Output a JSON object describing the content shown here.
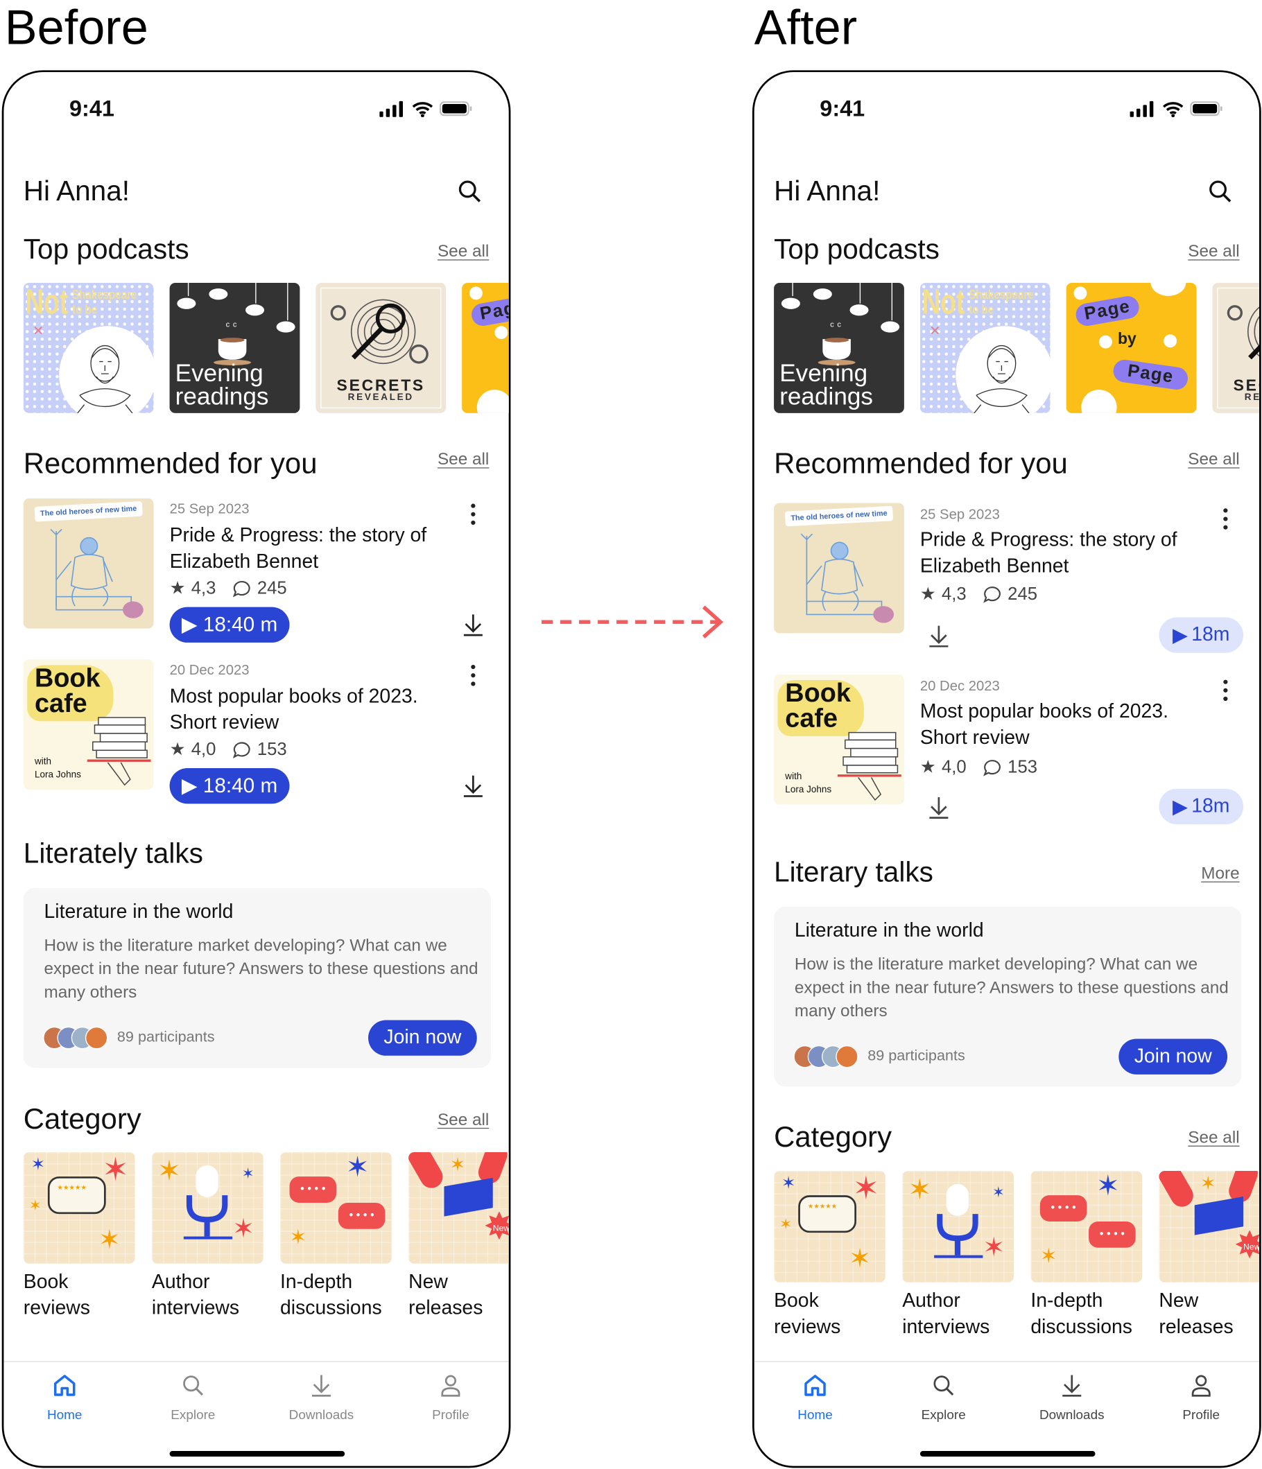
{
  "labels": {
    "before": "Before",
    "after": "After"
  },
  "colors": {
    "accent": "#2a44d4",
    "accent_light": "#dfe4fd",
    "nav_active": "#1d6ff0",
    "arrow": "#f25c5c",
    "card_bg": "#f6f6f6"
  },
  "podcast_art": {
    "shakespeare": {
      "big": "Not",
      "small1": "Shakespeare",
      "small2": "to be"
    },
    "evening": {
      "line1": "Evening",
      "line2": "readings"
    },
    "secrets": {
      "line1": "SECRETS",
      "line2": "REVEALED"
    },
    "page": {
      "w1": "Page",
      "w2": "by",
      "w3": "Page"
    }
  },
  "episode_art": {
    "heroes": {
      "banner": "The old heroes of new time"
    },
    "bookcafe": {
      "line1": "Book",
      "line2": "cafe",
      "with": "with",
      "host": "Lora Johns"
    },
    "new_badge": "New"
  },
  "before": {
    "status": {
      "time": "9:41"
    },
    "greeting": "Hi Anna!",
    "top_podcasts": {
      "title": "Top podcasts",
      "see_all": "See all",
      "order": [
        "Not Shakespeare to be",
        "Evening readings",
        "Secrets revealed",
        "Page by Page"
      ]
    },
    "recommended": {
      "title": "Recommended for you",
      "see_all": "See all",
      "items": [
        {
          "date": "25 Sep 2023",
          "title": "Pride & Progress: the story of Elizabeth Bennet",
          "rating": "4,3",
          "comments": "245",
          "duration": "18:40 m"
        },
        {
          "date": "20 Dec 2023",
          "title": "Most popular books of 2023. Short review",
          "rating": "4,0",
          "comments": "153",
          "duration": "18:40 m"
        }
      ]
    },
    "talks": {
      "title": "Literately talks",
      "card": {
        "title": "Literature in the world",
        "body": "How is the literature market developing? What can we expect in the near future? Answers to these questions and many others",
        "participants": "89 participants",
        "join": "Join now"
      }
    },
    "category": {
      "title": "Category",
      "see_all": "See all",
      "items": [
        "Book reviews",
        "Author interviews",
        "In-depth discussions",
        "New releases"
      ]
    },
    "nav": {
      "items": [
        {
          "label": "Home",
          "icon": "home-icon",
          "active": true
        },
        {
          "label": "Explore",
          "icon": "search-icon"
        },
        {
          "label": "Downloads",
          "icon": "download-icon"
        },
        {
          "label": "Profile",
          "icon": "person-icon"
        }
      ]
    }
  },
  "after": {
    "status": {
      "time": "9:41"
    },
    "greeting": "Hi Anna!",
    "top_podcasts": {
      "title": "Top podcasts",
      "see_all": "See all",
      "order": [
        "Evening readings",
        "Not Shakespeare to be",
        "Page by Page",
        "Secrets revealed"
      ]
    },
    "recommended": {
      "title": "Recommended for you",
      "see_all": "See all",
      "items": [
        {
          "date": "25 Sep 2023",
          "title": "Pride & Progress: the story of Elizabeth Bennet",
          "rating": "4,3",
          "comments": "245",
          "duration": "18m"
        },
        {
          "date": "20 Dec 2023",
          "title": "Most popular books of 2023. Short review",
          "rating": "4,0",
          "comments": "153",
          "duration": "18m"
        }
      ]
    },
    "talks": {
      "title": "Literary talks",
      "more": "More",
      "card": {
        "title": "Literature in the world",
        "body": "How is the literature market developing? What can we expect in the near future? Answers to these questions and many others",
        "participants": "89 participants",
        "join": "Join now"
      }
    },
    "category": {
      "title": "Category",
      "see_all": "See all",
      "items": [
        "Book reviews",
        "Author interviews",
        "In-depth discussions",
        "New releases"
      ]
    },
    "nav": {
      "items": [
        {
          "label": "Home",
          "icon": "home-icon",
          "active": true
        },
        {
          "label": "Explore",
          "icon": "search-icon"
        },
        {
          "label": "Downloads",
          "icon": "download-icon"
        },
        {
          "label": "Profile",
          "icon": "person-icon"
        }
      ]
    }
  }
}
